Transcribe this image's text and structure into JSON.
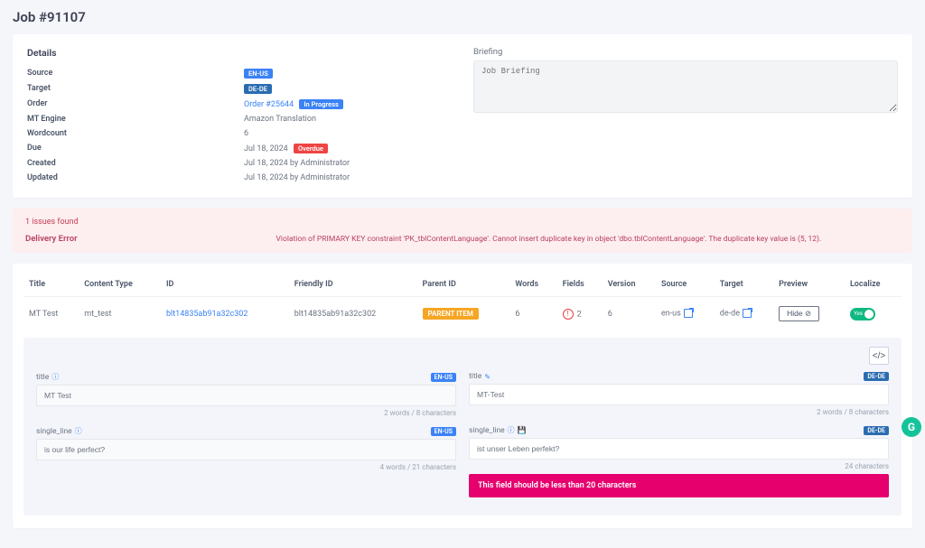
{
  "page": {
    "title": "Job #91107"
  },
  "details": {
    "heading": "Details",
    "rows": {
      "source": {
        "label": "Source",
        "badge": "EN-US"
      },
      "target": {
        "label": "Target",
        "badge": "DE-DE"
      },
      "order": {
        "label": "Order",
        "link": "Order #25644",
        "status": "In Progress"
      },
      "mt": {
        "label": "MT Engine",
        "value": "Amazon Translation"
      },
      "wc": {
        "label": "Wordcount",
        "value": "6"
      },
      "due": {
        "label": "Due",
        "value": "Jul 18, 2024",
        "flag": "Overdue"
      },
      "created": {
        "label": "Created",
        "value": "Jul 18, 2024 by Administrator"
      },
      "updated": {
        "label": "Updated",
        "value": "Jul 18, 2024 by Administrator"
      }
    },
    "briefing": {
      "label": "Briefing",
      "placeholder": "Job Briefing"
    }
  },
  "alert": {
    "count": "1 issues found",
    "title": "Delivery Error",
    "message": "Violation of PRIMARY KEY constraint 'PK_tblContentLanguage'. Cannot insert duplicate key in object 'dbo.tblContentLanguage'. The duplicate key value is (5, 12)."
  },
  "table": {
    "headers": {
      "title": "Title",
      "ctype": "Content Type",
      "id": "ID",
      "fid": "Friendly ID",
      "pid": "Parent ID",
      "words": "Words",
      "fields": "Fields",
      "version": "Version",
      "source": "Source",
      "target": "Target",
      "preview": "Preview",
      "localize": "Localize"
    },
    "row": {
      "title": "MT Test",
      "ctype": "mt_test",
      "id": "blt14835ab91a32c302",
      "fid": "blt14835ab91a32c302",
      "parent": "PARENT ITEM",
      "words": "6",
      "fields": "2",
      "version": "6",
      "source": "en-us",
      "target": "de-de",
      "hide": "Hide",
      "toggle": "Yes"
    }
  },
  "editor": {
    "left": {
      "lang": "EN-US",
      "title": {
        "name": "title",
        "value": "MT Test",
        "count": "2 words / 8 characters"
      },
      "single": {
        "name": "single_line",
        "value": "is our life perfect?",
        "count": "4 words / 21 characters"
      }
    },
    "right": {
      "lang": "DE-DE",
      "title": {
        "name": "title",
        "value": "MT-Test",
        "count": "2 words / 8 characters"
      },
      "single": {
        "name": "single_line",
        "value": "ist unser Leben perfekt?",
        "count": "24 characters",
        "error": "This field should be less than 20 characters"
      }
    }
  }
}
